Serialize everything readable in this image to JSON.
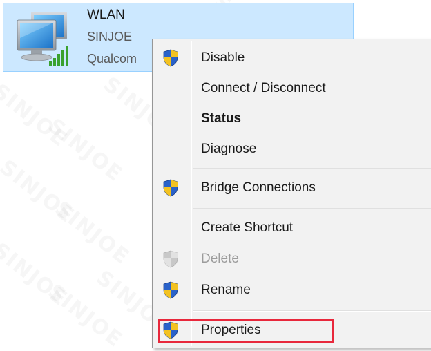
{
  "adapter": {
    "name": "WLAN",
    "ssid": "SINJOE",
    "driver": "Qualcom",
    "icon": "network-adapter-icon",
    "signal_icon": "signal-strength-icon"
  },
  "context_menu": {
    "items": [
      {
        "label": "Disable",
        "shield": true,
        "enabled": true
      },
      {
        "label": "Connect / Disconnect",
        "shield": false,
        "enabled": true
      },
      {
        "label": "Status",
        "shield": false,
        "enabled": true,
        "bold": true
      },
      {
        "label": "Diagnose",
        "shield": false,
        "enabled": true
      },
      {
        "label": "Bridge Connections",
        "shield": true,
        "enabled": true
      },
      {
        "label": "Create Shortcut",
        "shield": false,
        "enabled": true
      },
      {
        "label": "Delete",
        "shield": true,
        "enabled": false
      },
      {
        "label": "Rename",
        "shield": true,
        "enabled": true
      },
      {
        "label": "Properties",
        "shield": true,
        "enabled": true,
        "highlighted": true
      }
    ]
  },
  "watermark": "SINJOE",
  "colors": {
    "selection_bg": "#cce8ff",
    "selection_border": "#99d1ff",
    "menu_bg": "#f2f2f2",
    "highlight_box": "#e8283c",
    "shield_blue": "#2a62c9",
    "shield_yellow": "#f3c221"
  }
}
